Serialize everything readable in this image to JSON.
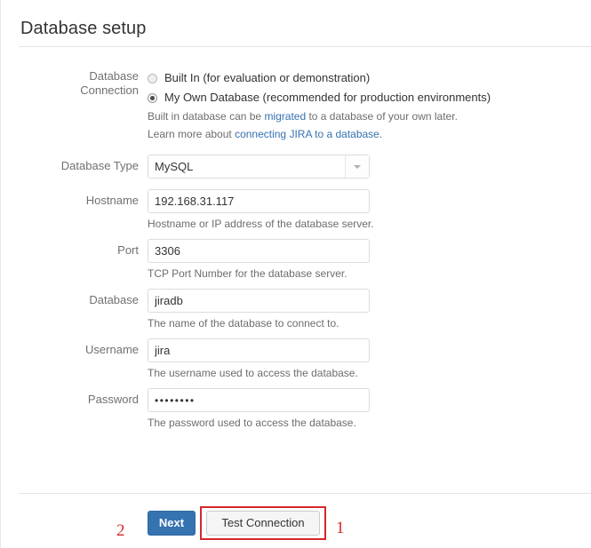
{
  "page": {
    "title": "Database setup"
  },
  "form": {
    "connection": {
      "label_line1": "Database",
      "label_line2": "Connection",
      "options": [
        {
          "label": "Built In (for evaluation or demonstration)",
          "selected": false
        },
        {
          "label": "My Own Database (recommended for production environments)",
          "selected": true
        }
      ],
      "note1_prefix": "Built in database can be ",
      "note1_link": "migrated",
      "note1_suffix": " to a database of your own later.",
      "note2_prefix": "Learn more about ",
      "note2_link": "connecting JIRA to a database",
      "note2_suffix": "."
    },
    "database_type": {
      "label": "Database Type",
      "value": "MySQL",
      "icon": "chevron-down-icon"
    },
    "hostname": {
      "label": "Hostname",
      "value": "192.168.31.117",
      "placeholder": "",
      "help": "Hostname or IP address of the database server."
    },
    "port": {
      "label": "Port",
      "value": "3306",
      "placeholder": "",
      "help": "TCP Port Number for the database server."
    },
    "database": {
      "label": "Database",
      "value": "jiradb",
      "placeholder": "",
      "help": "The name of the database to connect to."
    },
    "username": {
      "label": "Username",
      "value": "jira",
      "placeholder": "",
      "help": "The username used to access the database."
    },
    "password": {
      "label": "Password",
      "value": "••••••••",
      "placeholder": "",
      "help": "The password used to access the database."
    }
  },
  "footer": {
    "next_label": "Next",
    "test_label": "Test Connection"
  },
  "annotations": {
    "marker_1": "1",
    "marker_2": "2",
    "highlight_color": "#d4282a"
  },
  "colors": {
    "primary_button": "#3572b0",
    "link": "#3572b0",
    "label_text": "#707070",
    "help_text": "#6d6d6d",
    "annotation_red": "#d4282a"
  }
}
